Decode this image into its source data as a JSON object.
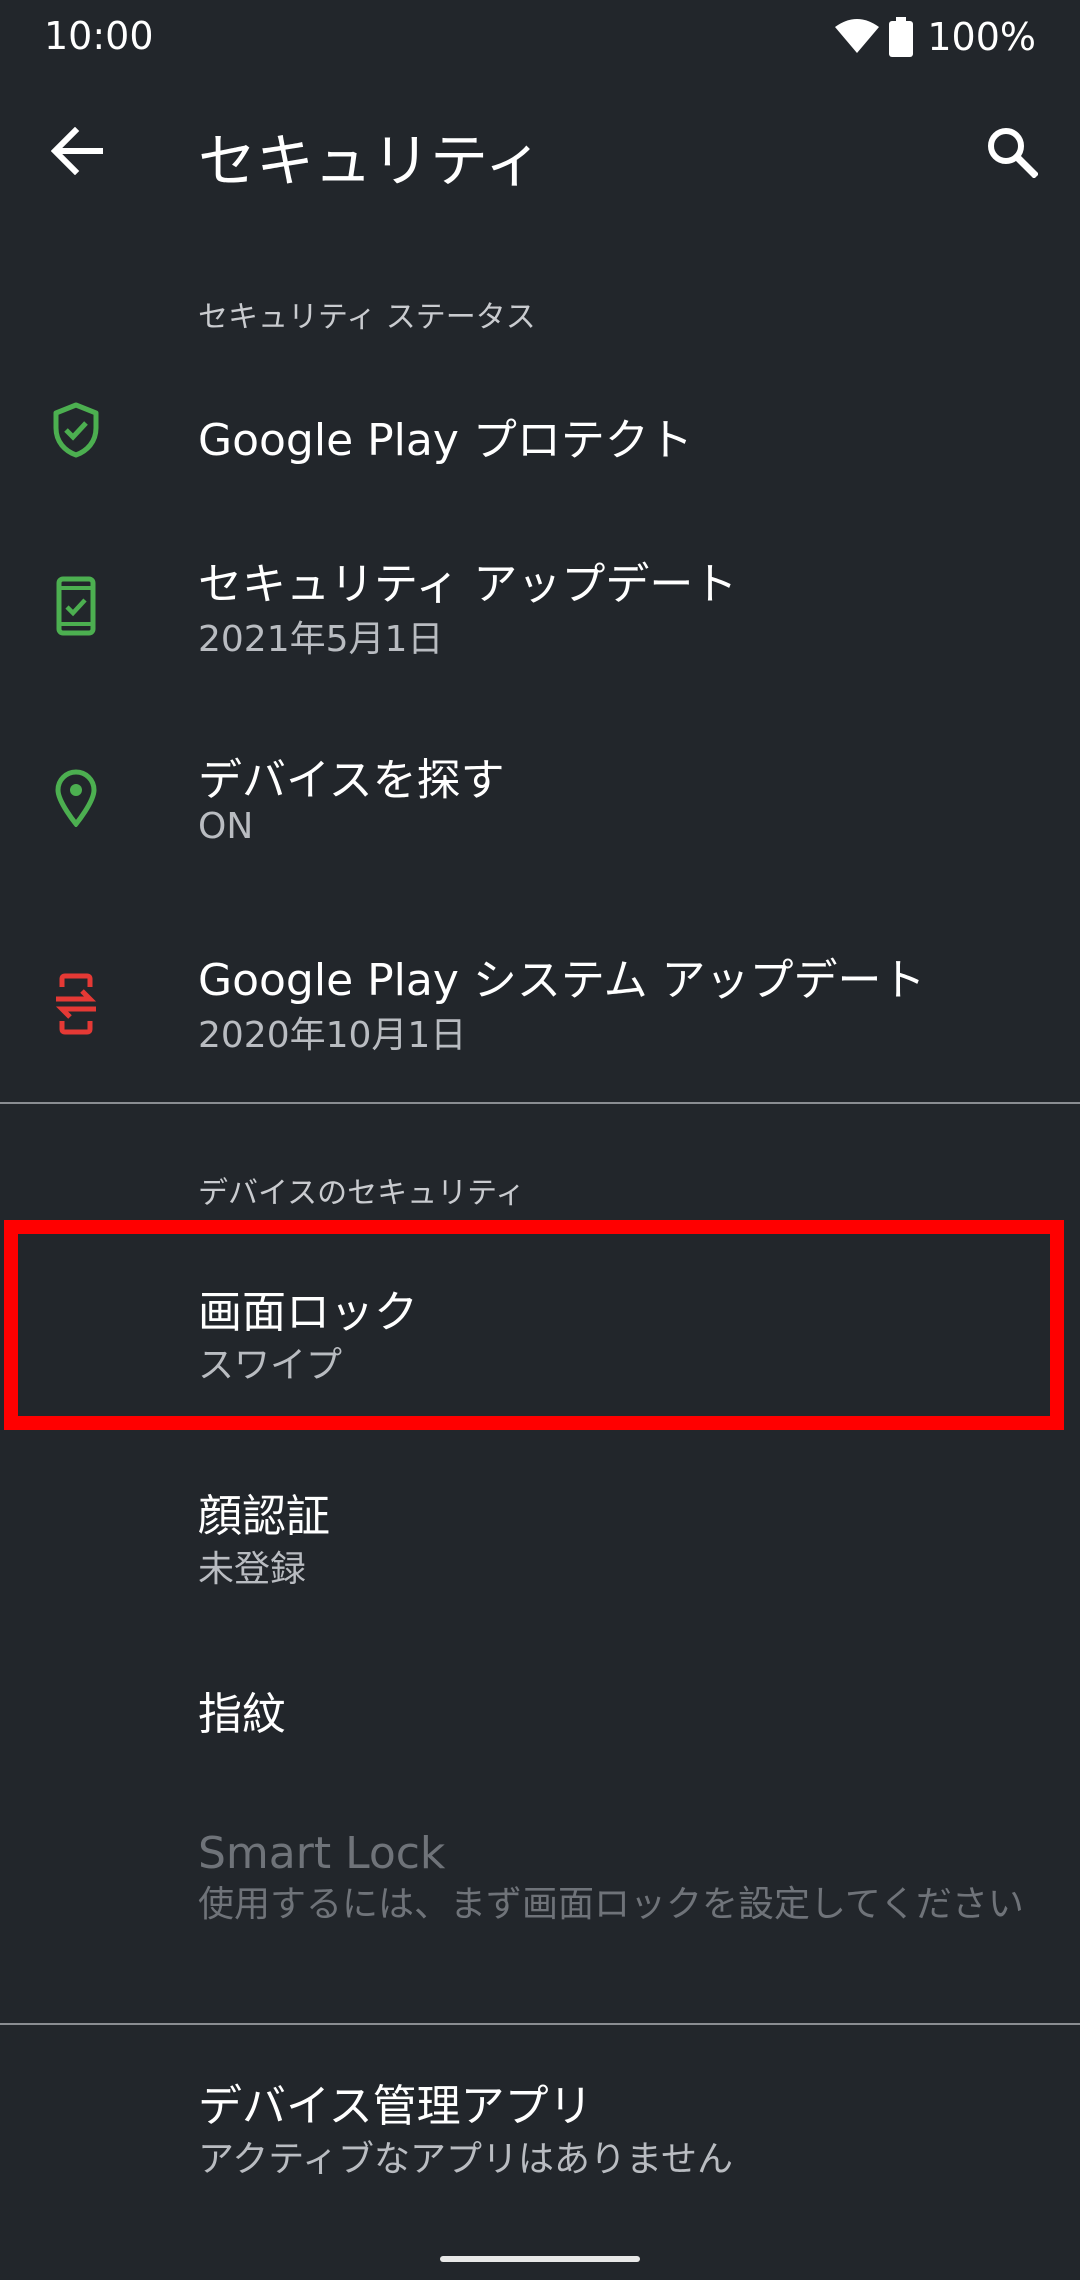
{
  "status_bar": {
    "time": "10:00",
    "battery": "100%"
  },
  "app_bar": {
    "title": "セキュリティ"
  },
  "sections": {
    "security_status": "セキュリティ ステータス",
    "device_security": "デバイスのセキュリティ"
  },
  "items": {
    "play_protect": {
      "title": "Google Play プロテクト"
    },
    "security_update": {
      "title": "セキュリティ アップデート",
      "summary": "2021年5月1日"
    },
    "find_device": {
      "title": "デバイスを探す",
      "summary": "ON"
    },
    "system_update": {
      "title": "Google Play システム アップデート",
      "summary": "2020年10月1日"
    },
    "screen_lock": {
      "title": "画面ロック",
      "summary": "スワイプ"
    },
    "face_auth": {
      "title": "顔認証",
      "summary": "未登録"
    },
    "fingerprint": {
      "title": "指紋"
    },
    "smart_lock": {
      "title": "Smart Lock",
      "summary": "使用するには、まず画面ロックを設定してください"
    },
    "device_admin": {
      "title": "デバイス管理アプリ",
      "summary": "アクティブなアプリはありません"
    }
  },
  "colors": {
    "background": "#22262b",
    "icon_green": "#4caf50",
    "icon_red": "#e53935",
    "highlight": "#ff0000"
  }
}
